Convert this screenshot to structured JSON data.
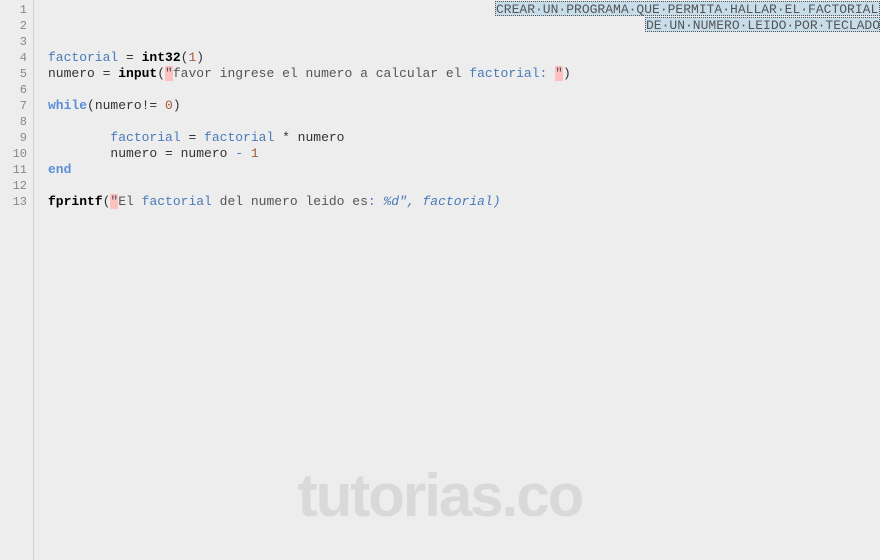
{
  "gutter": {
    "lines": [
      "1",
      "2",
      "3",
      "4",
      "5",
      "6",
      "7",
      "8",
      "9",
      "10",
      "11",
      "12",
      "13"
    ]
  },
  "header": {
    "line1": "CREAR·UN·PROGRAMA·QUE·PERMITA·HALLAR·EL·FACTORIAL",
    "line2": "DE·UN·NUMERO·LEIDO·POR·TECLADO"
  },
  "code": {
    "l4_a": "factorial",
    "l4_b": " = ",
    "l4_c": "int32",
    "l4_d": "(",
    "l4_e": "1",
    "l4_f": ")",
    "l5_a": "numero = ",
    "l5_b": "input",
    "l5_c": "(",
    "l5_q1": "\"",
    "l5_d": "favor ingrese el numero a calcular el ",
    "l5_e": "factorial",
    "l5_f": ": ",
    "l5_q2": "\"",
    "l5_g": ")",
    "l7_a": "while",
    "l7_b": "(numero!= ",
    "l7_c": "0",
    "l7_d": ")",
    "l9_a": "        ",
    "l9_b": "factorial",
    "l9_c": " = ",
    "l9_d": "factorial",
    "l9_e": " * numero",
    "l10_a": "        numero = numero ",
    "l10_b": "-",
    "l10_c": " ",
    "l10_d": "1",
    "l11_a": "end",
    "l13_a": "fprintf",
    "l13_b": "(",
    "l13_q1": "\"",
    "l13_c": "El ",
    "l13_d": "factorial",
    "l13_e": " del numero leido es",
    "l13_f": ": ",
    "l13_g": "%d\", factorial)"
  },
  "watermark": "tutorias.co"
}
